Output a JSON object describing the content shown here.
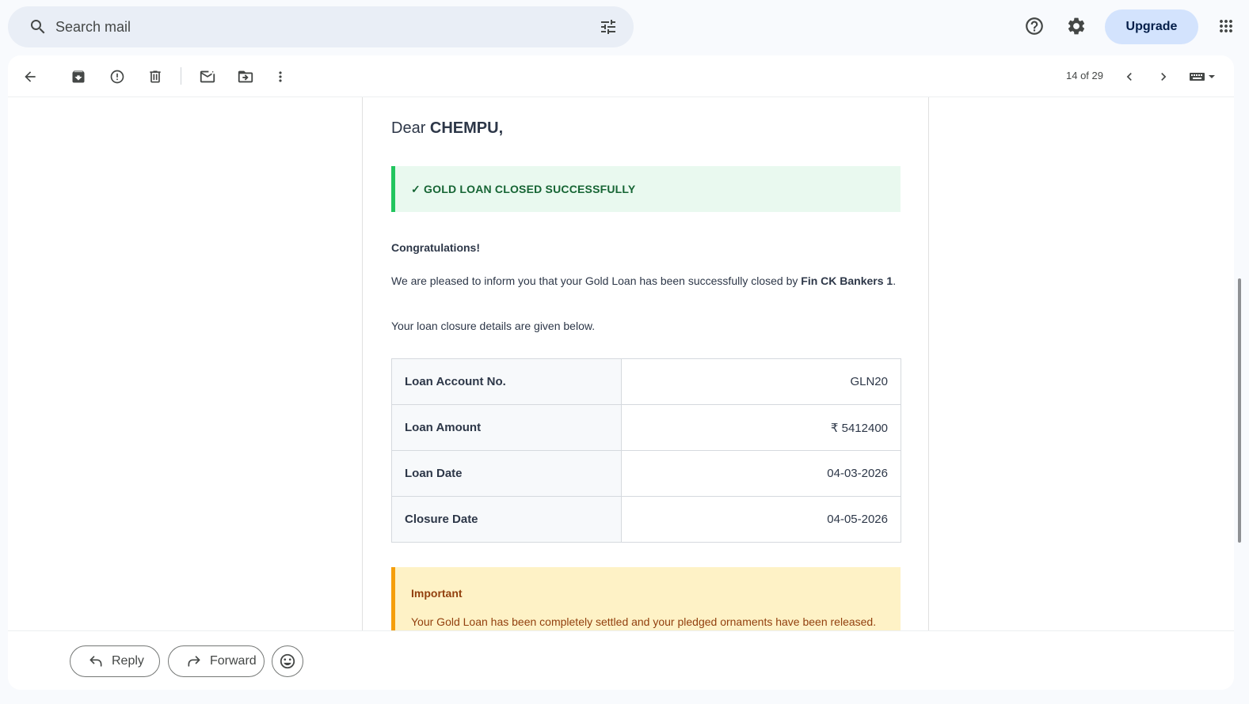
{
  "search": {
    "placeholder": "Search mail"
  },
  "header": {
    "upgrade_label": "Upgrade"
  },
  "toolbar": {
    "counter": "14 of 29"
  },
  "email": {
    "greeting_prefix": "Dear ",
    "recipient_name": "CHEMPU",
    "greeting_suffix": ",",
    "success_banner": "✓ GOLD LOAN CLOSED SUCCESSFULLY",
    "congrats": "Congratulations!",
    "intro_text": "We are pleased to inform you that your Gold Loan has been successfully closed by ",
    "bank_name": "Fin CK Bankers 1",
    "intro_end": ".",
    "details_intro": "Your loan closure details are given below.",
    "details": [
      {
        "label": "Loan Account No.",
        "value": "GLN20"
      },
      {
        "label": "Loan Amount",
        "value": "₹ 5412400"
      },
      {
        "label": "Loan Date",
        "value": "04-03-2026"
      },
      {
        "label": "Closure Date",
        "value": "04-05-2026"
      }
    ],
    "important_title": "Important",
    "important_text": "Your Gold Loan has been completely settled and your pledged ornaments have been released."
  },
  "reply_bar": {
    "reply_label": "Reply",
    "forward_label": "Forward"
  },
  "colors": {
    "accent": "#d3e3fd",
    "success": "#22c55e",
    "warning": "#f59e0b"
  }
}
